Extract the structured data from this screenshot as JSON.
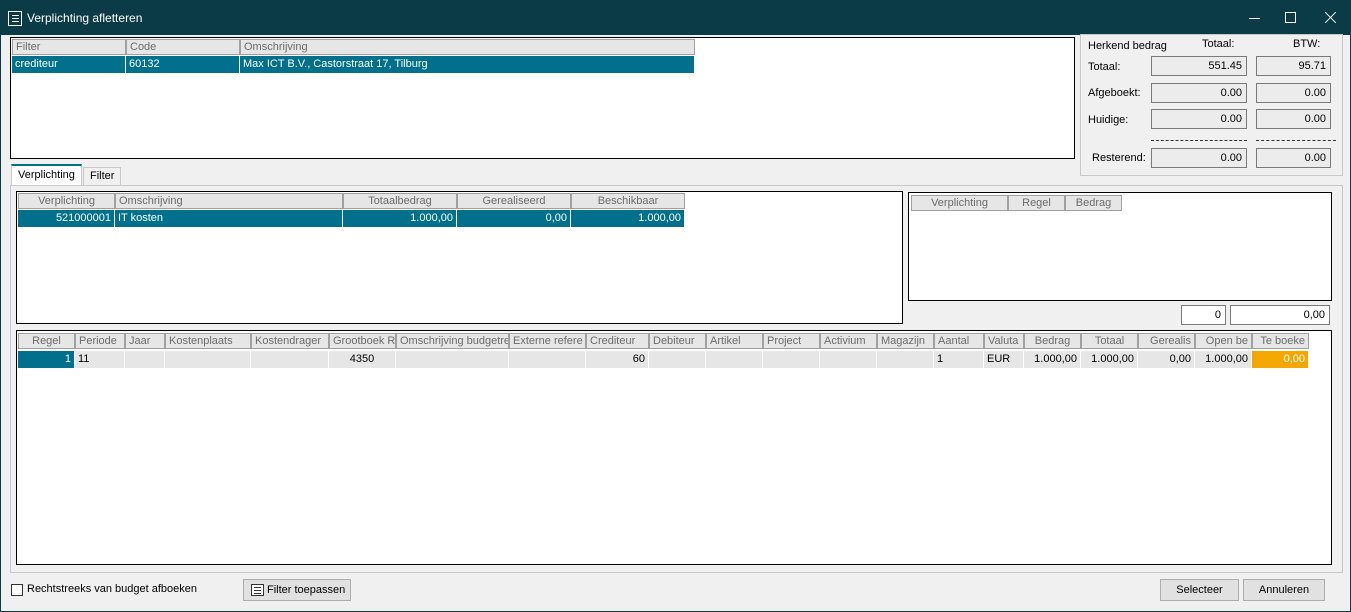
{
  "window": {
    "title": "Verplichting afletteren"
  },
  "filter_grid": {
    "headers": [
      "Filter",
      "Code",
      "Omschrijving"
    ],
    "row": [
      "crediteur",
      "60132",
      "Max ICT B.V., Castorstraat 17, Tilburg"
    ]
  },
  "summary": {
    "heading": "Herkend bedrag",
    "col_totaal": "Totaal:",
    "col_btw": "BTW:",
    "rows": [
      {
        "label": "Totaal:",
        "totaal": "551.45",
        "btw": "95.71"
      },
      {
        "label": "Afgeboekt:",
        "totaal": "0.00",
        "btw": "0.00"
      },
      {
        "label": "Huidige:",
        "totaal": "0.00",
        "btw": "0.00"
      },
      {
        "label": "Resterend:",
        "totaal": "0.00",
        "btw": "0.00"
      }
    ]
  },
  "tabs": [
    {
      "label": "Verplichting",
      "active": true
    },
    {
      "label": "Filter",
      "active": false
    }
  ],
  "verplichting_grid": {
    "headers": [
      "Verplichting",
      "Omschrijving",
      "Totaalbedrag",
      "Gerealiseerd",
      "Beschikbaar"
    ],
    "row": [
      "521000001",
      "IT kosten",
      "1.000,00",
      "0,00",
      "1.000,00"
    ]
  },
  "right_grid": {
    "headers": [
      "Verplichting",
      "Regel",
      "Bedrag"
    ]
  },
  "counters": {
    "count": "0",
    "amount": "0,00"
  },
  "regels_grid": {
    "headers": [
      "Regel",
      "Periode",
      "Jaar",
      "Kostenplaats",
      "Kostendrager",
      "Grootboek Re",
      "Omschrijving budgetre",
      "Externe refere",
      "Crediteur",
      "Debiteur",
      "Artikel",
      "Project",
      "Activium",
      "Magazijn",
      "Aantal",
      "Valuta",
      "Bedrag",
      "Totaal",
      "Gerealis",
      "Open be",
      "Te boeke"
    ],
    "row": [
      "1",
      "11",
      "",
      "",
      "",
      "4350",
      "",
      "",
      "60",
      "",
      "",
      "",
      "",
      "",
      "1",
      "EUR",
      "1.000,00",
      "1.000,00",
      "0,00",
      "1.000,00",
      "0,00"
    ]
  },
  "footer": {
    "checkbox_label": "Rechtstreeks van budget afboeken",
    "filter_button": "Filter toepassen",
    "select_button": "Selecteer",
    "cancel_button": "Annuleren"
  },
  "colors": {
    "selection": "#00708d",
    "highlight": "#f4a700",
    "titlebar": "#0b3b47"
  }
}
